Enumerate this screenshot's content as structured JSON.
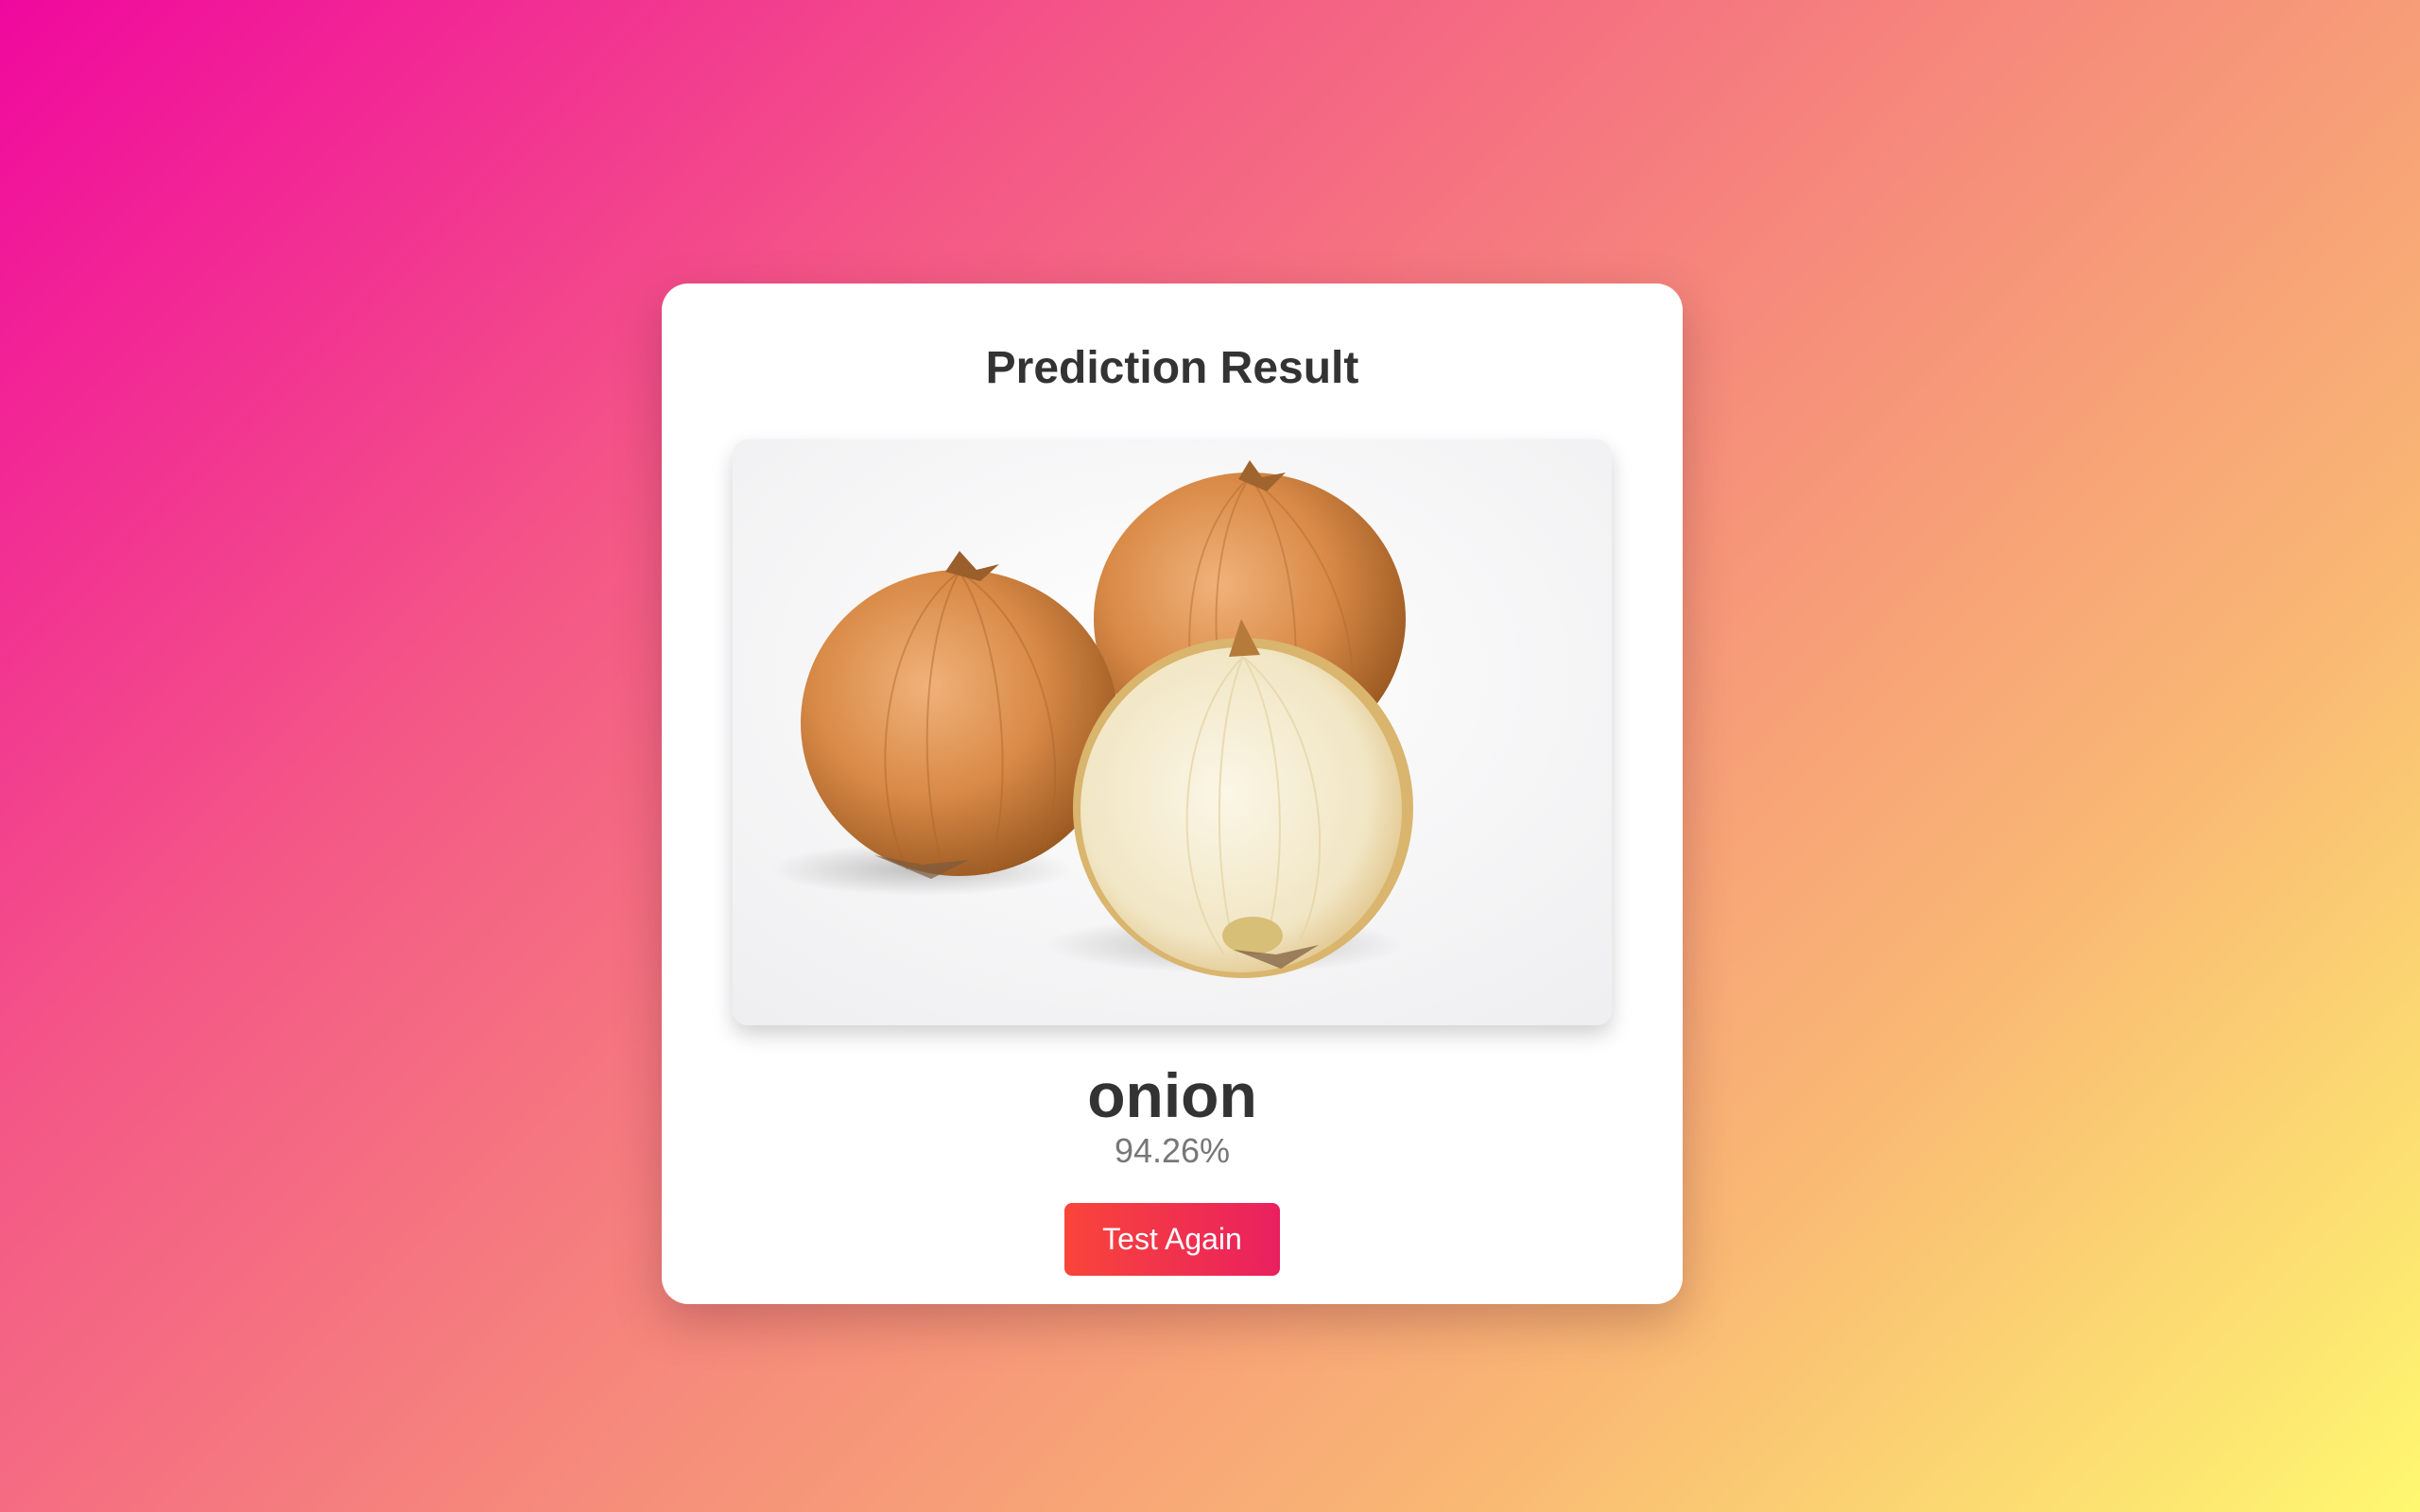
{
  "result_card": {
    "title": "Prediction Result",
    "image": {
      "icon": "onion-photo",
      "subject": "three onions, one cut in half"
    },
    "predicted_label": "onion",
    "confidence": "94.26%",
    "action_button": "Test Again"
  },
  "colors": {
    "background_gradient": [
      "#f0089e",
      "#f6907a",
      "#fef870"
    ],
    "button_gradient": [
      "#f9453a",
      "#e9205f"
    ],
    "title_text": "#333333",
    "confidence_text": "#777777",
    "card_background": "#ffffff"
  }
}
